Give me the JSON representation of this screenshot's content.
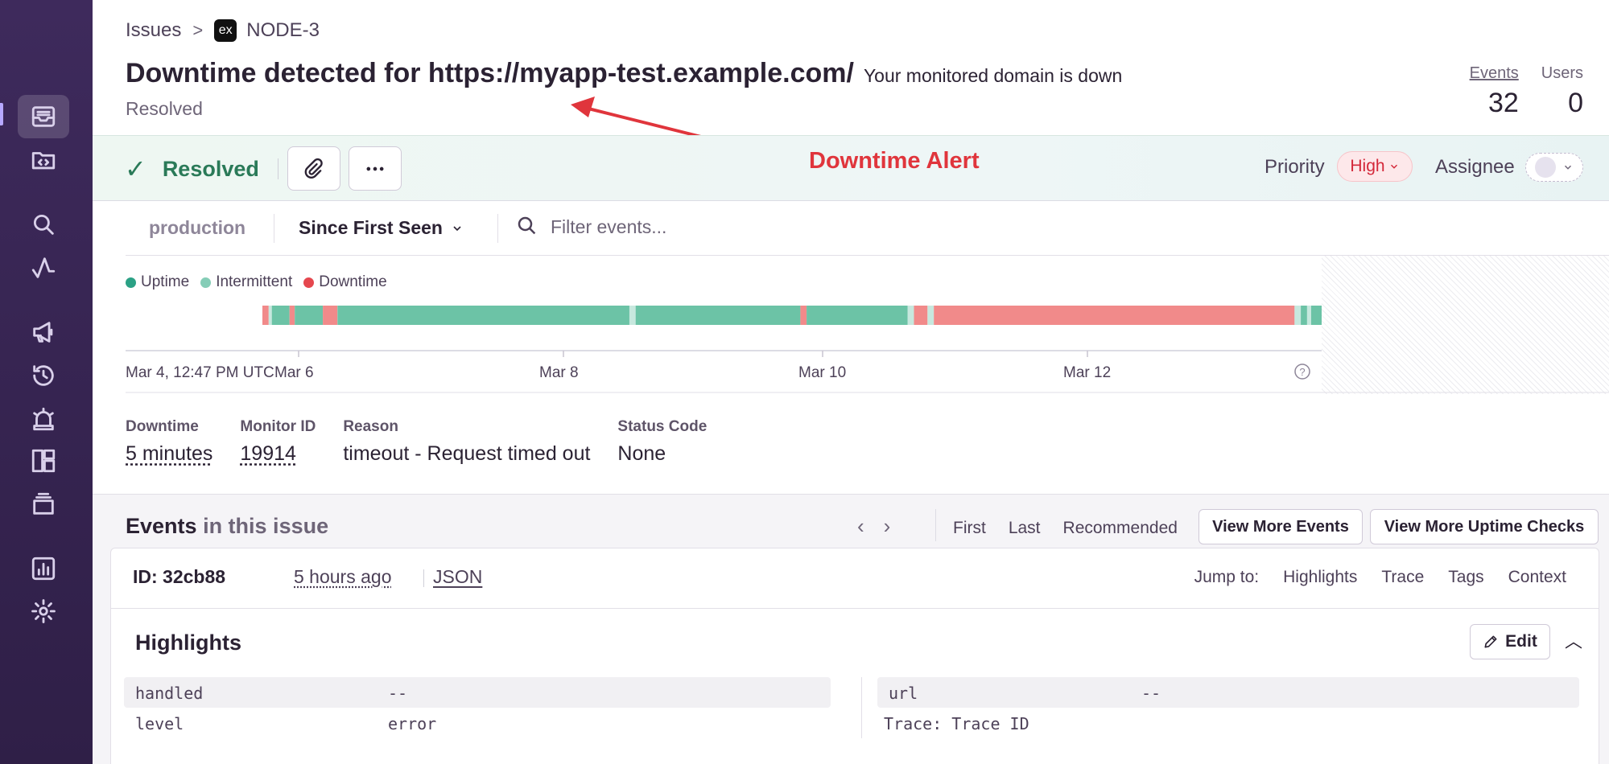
{
  "breadcrumb": {
    "root": "Issues",
    "project_badge": "ex",
    "project": "NODE-3"
  },
  "issue": {
    "title": "Downtime detected for https://myapp-test.example.com/",
    "subtitle": "Your monitored domain is down",
    "status_sub": "Resolved"
  },
  "stats": {
    "events_label": "Events",
    "events_value": "32",
    "users_label": "Users",
    "users_value": "0"
  },
  "action_bar": {
    "status": "Resolved",
    "annotation": "Downtime Alert",
    "priority_label": "Priority",
    "priority_value": "High",
    "assignee_label": "Assignee"
  },
  "filters": {
    "environment": "production",
    "period": "Since First Seen",
    "search_placeholder": "Filter events..."
  },
  "legend": [
    {
      "label": "Uptime",
      "color": "#2ba185"
    },
    {
      "label": "Intermittent",
      "color": "#85cdb7"
    },
    {
      "label": "Downtime",
      "color": "#e5474e"
    }
  ],
  "timeline": {
    "start_label": "Mar 4, 12:47 PM UTC",
    "ticks": [
      "Mar 6",
      "Mar 8",
      "Mar 10",
      "Mar 12"
    ],
    "colors": {
      "up": "#6cc3a6",
      "int": "#c7e8de",
      "down": "#f18a8a"
    },
    "segments": [
      {
        "s": "down",
        "w": 0.6
      },
      {
        "s": "int",
        "w": 0.3
      },
      {
        "s": "up",
        "w": 1.7
      },
      {
        "s": "down",
        "w": 0.5
      },
      {
        "s": "up",
        "w": 2.7
      },
      {
        "s": "down",
        "w": 1.4
      },
      {
        "s": "up",
        "w": 28.0
      },
      {
        "s": "int",
        "w": 0.6
      },
      {
        "s": "up",
        "w": 15.8
      },
      {
        "s": "down",
        "w": 0.6
      },
      {
        "s": "up",
        "w": 9.7
      },
      {
        "s": "int",
        "w": 0.6
      },
      {
        "s": "down",
        "w": 1.3
      },
      {
        "s": "int",
        "w": 0.6
      },
      {
        "s": "down",
        "w": 34.6
      },
      {
        "s": "int",
        "w": 0.6
      },
      {
        "s": "up",
        "w": 0.6
      },
      {
        "s": "int",
        "w": 0.4
      },
      {
        "s": "up",
        "w": 1.0
      }
    ]
  },
  "details": [
    {
      "label": "Downtime",
      "value": "5 minutes",
      "underline": true
    },
    {
      "label": "Monitor ID",
      "value": "19914",
      "underline": true
    },
    {
      "label": "Reason",
      "value": "timeout - Request timed out",
      "underline": false
    },
    {
      "label": "Status Code",
      "value": "None",
      "underline": false
    }
  ],
  "events": {
    "title": "Events",
    "title_suffix": "in this issue",
    "links": [
      "First",
      "Last",
      "Recommended"
    ],
    "view_more_events": "View More Events",
    "view_more_uptime": "View More Uptime Checks",
    "event_id": "ID: 32cb88",
    "event_time": "5 hours ago",
    "event_json": "JSON",
    "jump_label": "Jump to:",
    "jump_links": [
      "Highlights",
      "Trace",
      "Tags",
      "Context"
    ],
    "highlights_title": "Highlights",
    "edit_label": "Edit",
    "highlights_left": [
      {
        "key": "handled",
        "value": "--"
      },
      {
        "key": "level",
        "value": "error"
      }
    ],
    "highlights_right": [
      {
        "key": "url",
        "value": "--"
      },
      {
        "key": "Trace: Trace ID",
        "value": ""
      }
    ]
  }
}
